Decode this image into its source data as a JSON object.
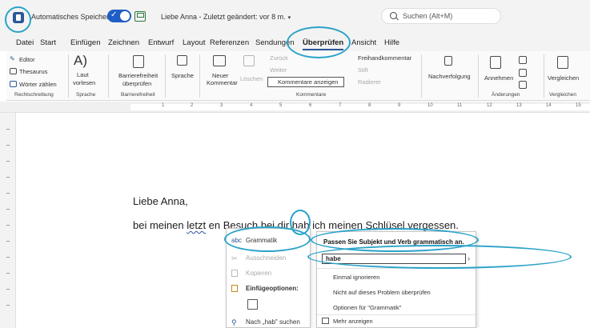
{
  "titlebar": {
    "autosave_label": "Automatisches Speichern",
    "toggle_check": "✓",
    "doc_title": "Liebe Anna  -  Zuletzt geändert: vor 8 m.",
    "dropdown_caret": "▾",
    "search_placeholder": "Suchen (Alt+M)"
  },
  "menu": {
    "tabs": [
      "Datei",
      "Start",
      "Einfügen",
      "Zeichnen",
      "Entwurf",
      "Layout",
      "Referenzen",
      "Sendungen",
      "Überprüfen",
      "Ansicht",
      "Hilfe"
    ],
    "active": "Überprüfen"
  },
  "ribbon": {
    "editor": "Editor",
    "thesaurus": "Thesaurus",
    "word_count": "Wörter zählen",
    "group_spelling": "Rechtschreibung",
    "read_aloud_1": "Laut",
    "read_aloud_2": "vorlesen",
    "group_speech": "Sprache",
    "access_1": "Barrierefreiheit",
    "access_2": "überprüfen",
    "group_access": "Barrierefreiheit",
    "language": "Sprache",
    "new_comment_1": "Neuer",
    "new_comment_2": "Kommentar",
    "delete": "Löschen",
    "previous": "Zurück",
    "next": "Weiter",
    "show_comments": "Kommentare anzeigen",
    "freehand": "Freihandkommentar",
    "pen": "Stift",
    "eraser": "Radierer",
    "group_comments": "Kommentare",
    "tracking": "Nachverfolgung",
    "accept": "Annehmen",
    "group_changes": "Änderungen",
    "compare": "Vergleichen",
    "group_compare": "Vergleichen"
  },
  "ruler": {
    "numbers": [
      "1",
      "2",
      "3",
      "4",
      "5",
      "6",
      "7",
      "8",
      "9",
      "10",
      "11",
      "12",
      "13",
      "14",
      "15"
    ]
  },
  "document": {
    "greeting": "Liebe Anna,",
    "line_part1": "bei meinen ",
    "line_err1": "letzt",
    "line_part2": " en Besuch bei dir ",
    "line_err2": "hab",
    "line_part3": " ich meinen ",
    "line_err3": "Schlüsel",
    "line_part4": " vergessen."
  },
  "context_menu": {
    "grammar": "Grammatik",
    "cut": "Ausschneiden",
    "copy": "Kopieren",
    "paste_options": "Einfügeoptionen:",
    "search": "Nach „hab\" suchen"
  },
  "grammar_menu": {
    "title": "Passen Sie Subjekt und Verb grammatisch an.",
    "suggestion": "habe",
    "arrow": "›",
    "ignore": "Einmal ignorieren",
    "dont_check": "Nicht auf dieses Problem überprüfen",
    "options": "Optionen für \"Grammatik\"",
    "more": "Mehr anzeigen"
  },
  "colors": {
    "accent": "#2b5797",
    "annotation": "#2aa3c9",
    "grammar_underline": "#2b5797",
    "spelling_underline": "#c62828"
  }
}
